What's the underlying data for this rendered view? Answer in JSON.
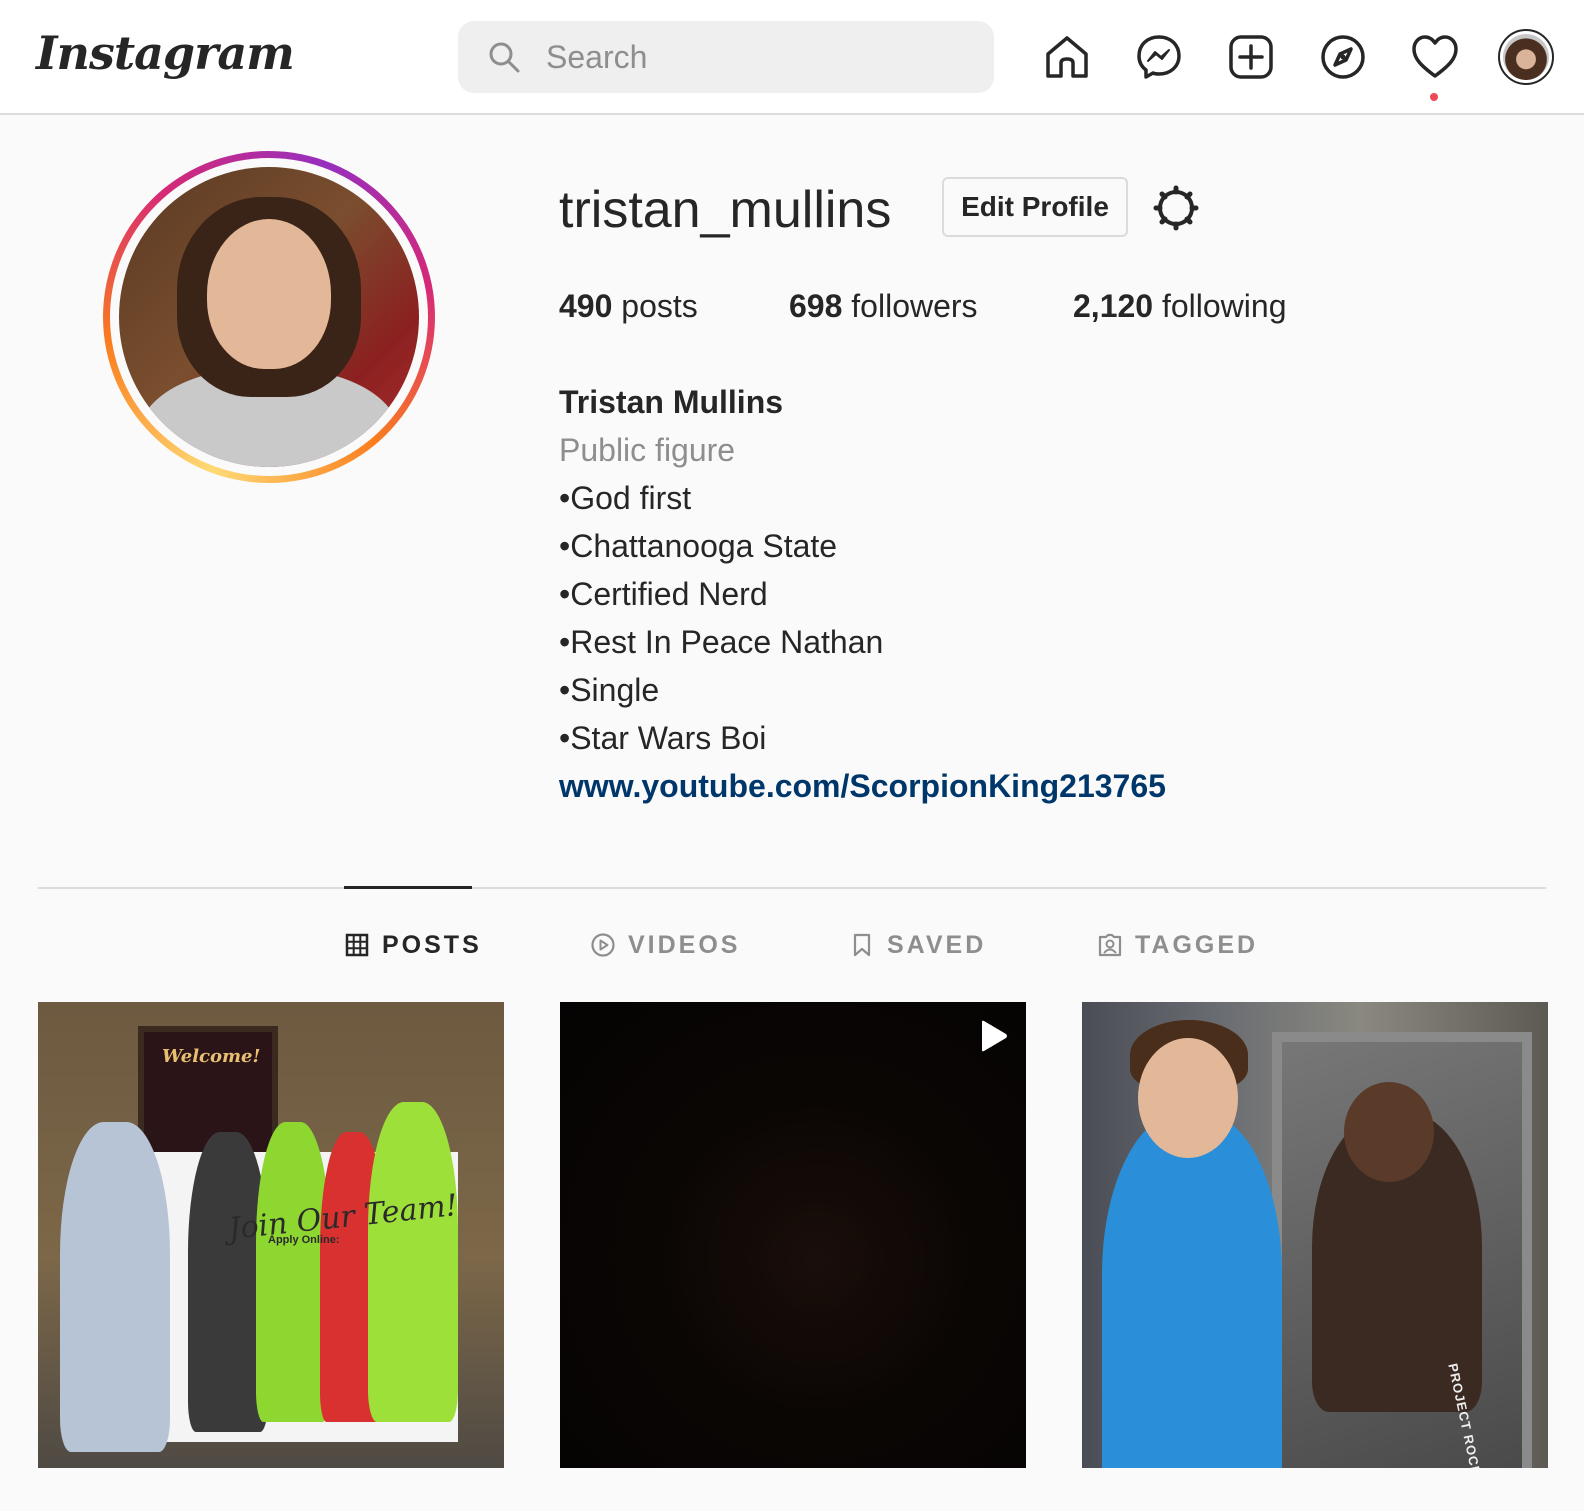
{
  "header": {
    "logo": "Instagram",
    "search_placeholder": "Search",
    "nav_icons": [
      "home-icon",
      "messenger-icon",
      "new-post-icon",
      "explore-icon",
      "activity-heart-icon",
      "profile-avatar"
    ]
  },
  "profile": {
    "username": "tristan_mullins",
    "edit_button": "Edit Profile",
    "posts_count": "490",
    "posts_label": "posts",
    "followers_count": "698",
    "followers_label": "followers",
    "following_count": "2,120",
    "following_label": "following",
    "full_name": "Tristan Mullins",
    "category": "Public figure",
    "bio_lines": [
      "•God first",
      "•Chattanooga State",
      "•Certified Nerd",
      "•Rest In Peace Nathan",
      "•Single",
      "•Star Wars Boi"
    ],
    "link": "www.youtube.com/ScorpionKing213765"
  },
  "tabs": [
    {
      "label": "POSTS",
      "icon": "grid-icon",
      "active": true
    },
    {
      "label": "VIDEOS",
      "icon": "play-circle-icon",
      "active": false
    },
    {
      "label": "SAVED",
      "icon": "bookmark-icon",
      "active": false
    },
    {
      "label": "TAGGED",
      "icon": "tagged-user-icon",
      "active": false
    }
  ],
  "posts": [
    {
      "type": "photo",
      "sign_text": "Welcome!",
      "overlay_text": "Join Our Team!",
      "sub_text": "Apply Online:"
    },
    {
      "type": "video"
    },
    {
      "type": "photo",
      "label_text": "PROJECT ROCK COLLEC"
    }
  ],
  "colors": {
    "link": "#00376b",
    "muted": "#8e8e8e",
    "notification_dot": "#ed4956",
    "border": "#dbdbdb"
  }
}
